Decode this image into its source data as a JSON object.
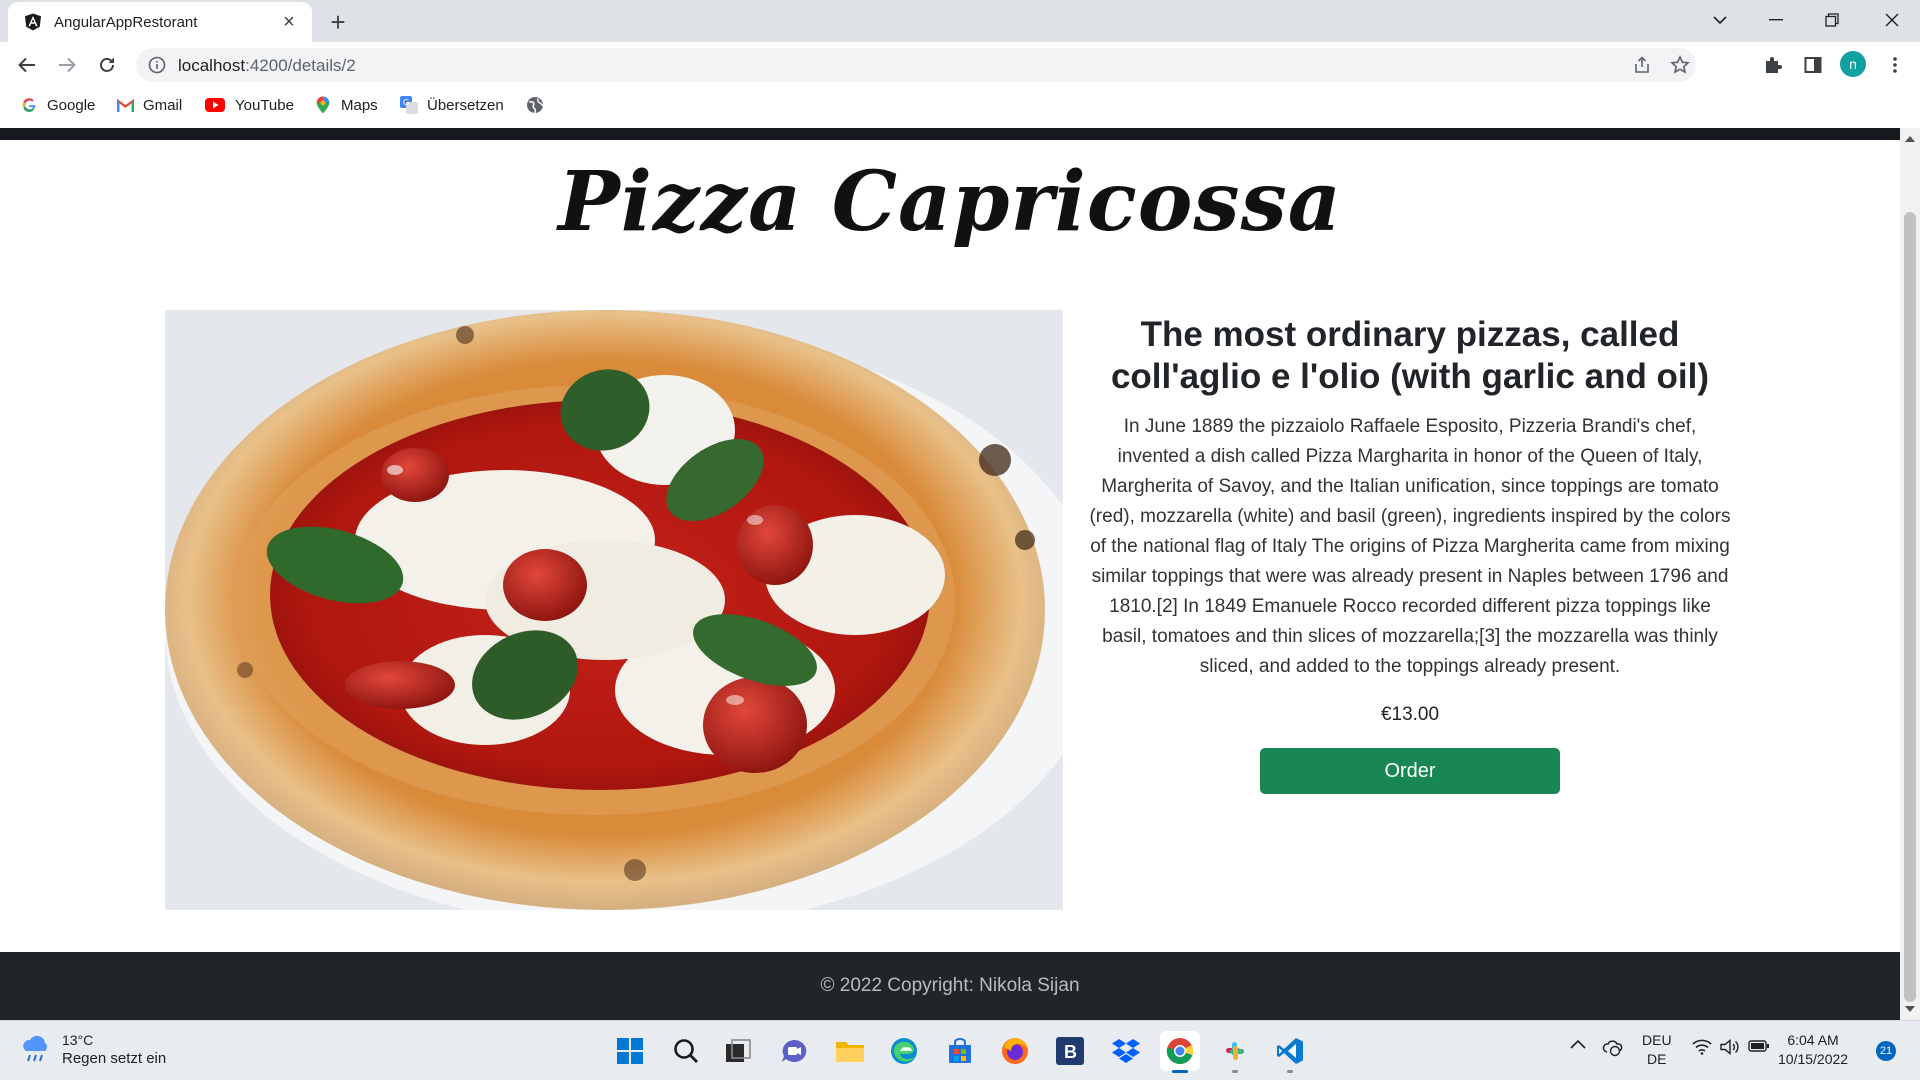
{
  "browser": {
    "tab_title": "AngularAppRestorant",
    "url_host": "localhost",
    "url_path": ":4200/details/2",
    "bookmarks": [
      "Google",
      "Gmail",
      "YouTube",
      "Maps",
      "Übersetzen"
    ],
    "profile_initial": "n"
  },
  "page": {
    "title": "Pizza Capricossa",
    "headline": "The most ordinary pizzas, called coll'aglio e l'olio (with garlic and oil)",
    "description": "In June 1889 the pizzaiolo Raffaele Esposito, Pizzeria Brandi's chef, invented a dish called Pizza Margharita in honor of the Queen of Italy, Margherita of Savoy, and the Italian unification, since toppings are tomato (red), mozzarella (white) and basil (green), ingredients inspired by the colors of the national flag of Italy The origins of Pizza Margherita came from mixing similar toppings that were was already present in Naples between 1796 and 1810.[2] In 1849 Emanuele Rocco recorded different pizza toppings like basil, tomatoes and thin slices of mozzarella;[3] the mozzarella was thinly sliced, and added to the toppings already present.",
    "price": "€13.00",
    "order_label": "Order",
    "footer": "© 2022 Copyright: Nikola Sijan",
    "colors": {
      "order_button": "#198754",
      "footer_bg": "#212529"
    }
  },
  "taskbar": {
    "temperature": "13°C",
    "weather": "Regen setzt ein",
    "lang_top": "DEU",
    "lang_bottom": "DE",
    "time": "6:04 AM",
    "date": "10/15/2022",
    "notifications": "21"
  }
}
